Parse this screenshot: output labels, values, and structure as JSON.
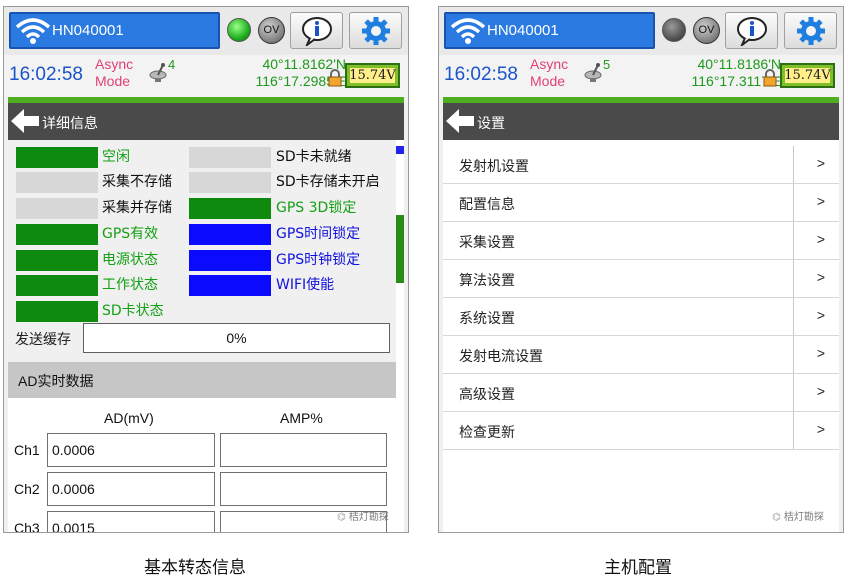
{
  "left": {
    "device_name": "HN040001",
    "led_state": "green",
    "ov_label": "OV",
    "info_icon": "info-icon",
    "settings_icon": "gear-icon",
    "time": "16:02:58",
    "mode_line1": "Async",
    "mode_line2": "Mode",
    "sat_count": "4",
    "lat": "40°11.8162'N",
    "lon": "116°17.2985'E",
    "battery": "15.74V",
    "title": "详细信息",
    "status_items": [
      {
        "color": "green",
        "label": "空闲",
        "label_color": "g"
      },
      {
        "color": "gray",
        "label": "SD卡未就绪",
        "label_color": "b"
      },
      {
        "color": "gray",
        "label": "采集不存储",
        "label_color": "b"
      },
      {
        "color": "gray",
        "label": "SD卡存储未开启",
        "label_color": "b"
      },
      {
        "color": "gray",
        "label": "采集并存储",
        "label_color": "b"
      },
      {
        "color": "green",
        "label": "GPS 3D锁定",
        "label_color": "g"
      },
      {
        "color": "green",
        "label": "GPS有效",
        "label_color": "g"
      },
      {
        "color": "blue",
        "label": "GPS时间锁定",
        "label_color": "bl"
      },
      {
        "color": "green",
        "label": "电源状态",
        "label_color": "g"
      },
      {
        "color": "blue",
        "label": "GPS时钟锁定",
        "label_color": "bl"
      },
      {
        "color": "green",
        "label": "工作状态",
        "label_color": "g"
      },
      {
        "color": "blue",
        "label": "WIFI使能",
        "label_color": "bl"
      },
      {
        "color": "green",
        "label": "SD卡状态",
        "label_color": "g"
      }
    ],
    "buffer_label": "发送缓存",
    "buffer_value": "0%",
    "ad_title": "AD实时数据",
    "ad_col1": "AD(mV)",
    "ad_col2": "AMP%",
    "channels": [
      {
        "name": "Ch1",
        "ad": "0.0006",
        "amp": ""
      },
      {
        "name": "Ch2",
        "ad": "0.0006",
        "amp": ""
      },
      {
        "name": "Ch3",
        "ad": "0.0015",
        "amp": ""
      }
    ],
    "watermark": "桔灯勘探",
    "caption": "基本转态信息"
  },
  "right": {
    "device_name": "HN040001",
    "led_state": "gray",
    "ov_label": "OV",
    "info_icon": "info-icon",
    "settings_icon": "gear-icon",
    "time": "16:02:58",
    "mode_line1": "Async",
    "mode_line2": "Mode",
    "sat_count": "5",
    "lat": "40°11.8186'N",
    "lon": "116°17.3117'E",
    "battery": "15.74V",
    "title": "设置",
    "menu": [
      {
        "label": "发射机设置",
        "arrow": ">"
      },
      {
        "label": "配置信息",
        "arrow": ">"
      },
      {
        "label": "采集设置",
        "arrow": ">"
      },
      {
        "label": "算法设置",
        "arrow": ">"
      },
      {
        "label": "系统设置",
        "arrow": ">"
      },
      {
        "label": "发射电流设置",
        "arrow": ">"
      },
      {
        "label": "高级设置",
        "arrow": ">"
      },
      {
        "label": "检查更新",
        "arrow": ">"
      }
    ],
    "watermark": "桔灯勘探",
    "caption": "主机配置"
  }
}
